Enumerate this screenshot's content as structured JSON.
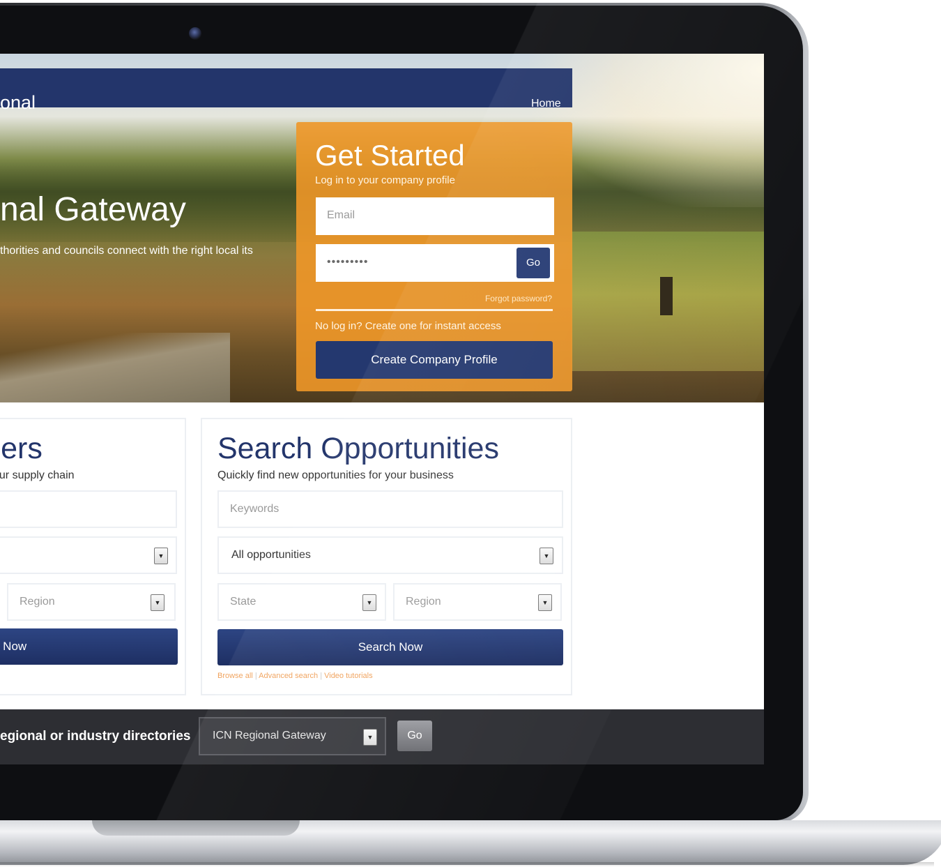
{
  "navbar": {
    "brand": "onal",
    "home_link": "Home"
  },
  "hero": {
    "title": "nal Gateway",
    "subtitle": "thorities and councils connect with the right local its"
  },
  "get_started": {
    "title": "Get Started",
    "subtitle": "Log in to your company profile",
    "email_placeholder": "Email",
    "password_value": "•••••••••",
    "go_label": "Go",
    "forgot_link": "Forgot password?",
    "no_login_text": "No log in? Create one for instant access",
    "create_button": "Create Company Profile"
  },
  "suppliers_panel": {
    "title": "liers",
    "subtitle": "your supply chain",
    "region_placeholder": "Region",
    "search_button": "h Now"
  },
  "opportunities_panel": {
    "title": "Search Opportunities",
    "subtitle": "Quickly find new opportunities for your business",
    "keywords_placeholder": "Keywords",
    "category_value": "All opportunities",
    "state_placeholder": "State",
    "region_placeholder": "Region",
    "search_button": "Search Now",
    "links": {
      "browse_all": "Browse all",
      "advanced_search": "Advanced search",
      "video_tutorials": "Video tutorials",
      "separator": "|"
    }
  },
  "directory_bar": {
    "label": "egional or industry directories",
    "selected": "ICN Regional Gateway",
    "go_label": "Go"
  },
  "colors": {
    "navy": "#23356b",
    "orange": "#ee9728",
    "link_orange": "#f0a15a",
    "dark_bar": "#2d2e33"
  },
  "icons": {
    "dropdown": "chevron-down-icon",
    "camera": "camera-icon"
  }
}
